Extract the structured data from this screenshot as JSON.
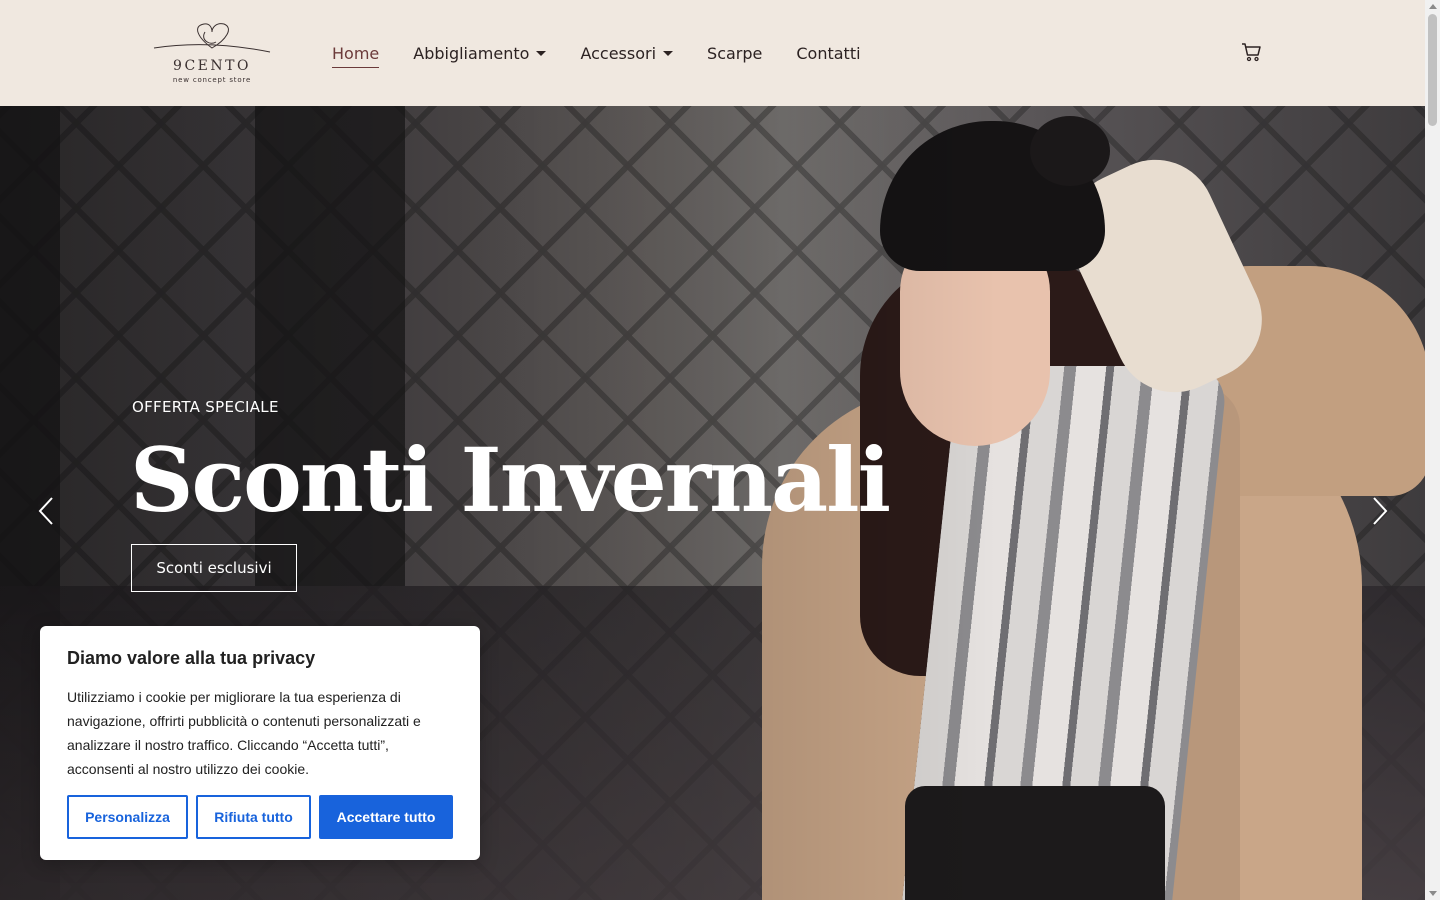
{
  "header": {
    "logo": {
      "name": "9CENTO",
      "tagline": "new concept store"
    },
    "nav": [
      {
        "label": "Home",
        "active": true,
        "has_dropdown": false
      },
      {
        "label": "Abbigliamento",
        "active": false,
        "has_dropdown": true
      },
      {
        "label": "Accessori",
        "active": false,
        "has_dropdown": true
      },
      {
        "label": "Scarpe",
        "active": false,
        "has_dropdown": false
      },
      {
        "label": "Contatti",
        "active": false,
        "has_dropdown": false
      }
    ],
    "cart_icon": "cart-icon"
  },
  "hero": {
    "eyebrow": "OFFERTA SPECIALE",
    "title": "Sconti Invernali",
    "button_label": "Sconti esclusivi",
    "prev_icon": "chevron-left-icon",
    "next_icon": "chevron-right-icon"
  },
  "cookie_banner": {
    "title": "Diamo valore alla tua privacy",
    "text": "Utilizziamo i cookie per migliorare la tua esperienza di navigazione, offrirti pubblicità o contenuti personalizzati e analizzare il nostro traffico. Cliccando “Accetta tutti”, acconsenti al nostro utilizzo dei cookie.",
    "buttons": {
      "customize": "Personalizza",
      "reject": "Rifiuta tutto",
      "accept": "Accettare tutto"
    }
  },
  "colors": {
    "header_bg": "#f0e8e0",
    "nav_active": "#6b3a3a",
    "cookie_primary": "#1863dc"
  }
}
